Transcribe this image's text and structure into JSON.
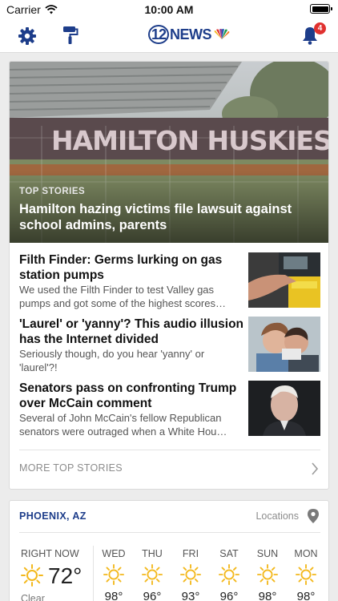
{
  "status_bar": {
    "carrier": "Carrier",
    "time": "10:00 AM"
  },
  "nav": {
    "notification_count": "4",
    "logo_number": "12",
    "logo_word": "NEWS"
  },
  "top_stories": {
    "hero": {
      "kicker": "TOP STORIES",
      "headline": "Hamilton hazing victims file lawsuit against school admins, parents",
      "sign_text": "HAMILTON HUSKIES"
    },
    "stories": [
      {
        "title": "Filth Finder: Germs lurking on gas station pumps",
        "summary": "We used the Filth Finder to test Valley gas pumps and got some of the highest scores…"
      },
      {
        "title": "'Laurel' or 'yanny'? This audio illusion has the Internet divided",
        "summary": "Seriously though, do you hear 'yanny' or 'laurel'?!"
      },
      {
        "title": "Senators pass on confronting Trump over McCain comment",
        "summary": "Several of John McCain's fellow Republican senators were outraged when a White Hou…"
      }
    ],
    "more_label": "MORE TOP STORIES"
  },
  "weather": {
    "city": "PHOENIX, AZ",
    "locations_label": "Locations",
    "now": {
      "label": "RIGHT NOW",
      "temp": "72°",
      "condition": "Clear"
    },
    "forecast": [
      {
        "day": "WED",
        "high": "98°"
      },
      {
        "day": "THU",
        "high": "96°"
      },
      {
        "day": "FRI",
        "high": "93°"
      },
      {
        "day": "SAT",
        "high": "96°"
      },
      {
        "day": "SUN",
        "high": "98°"
      },
      {
        "day": "MON",
        "high": "98°"
      }
    ]
  },
  "icons": {
    "settings": "gear-icon",
    "theme": "paint-roller-icon",
    "notifications": "bell-icon",
    "location": "map-pin-icon",
    "weather": "sun-icon",
    "chevron": "chevron-right-icon"
  },
  "colors": {
    "brand_blue": "#1d3d8a",
    "badge_red": "#e0312f",
    "sun_yellow": "#f3b81c",
    "background": "#ececec"
  }
}
